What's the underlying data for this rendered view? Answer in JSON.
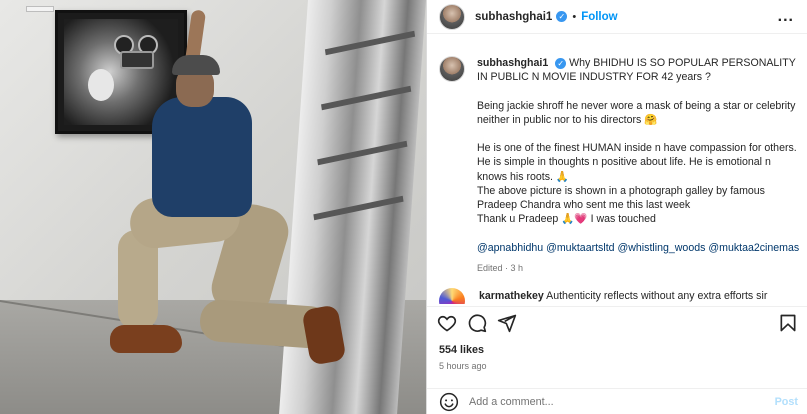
{
  "header": {
    "username": "subhashghai1",
    "separator": "•",
    "follow_label": "Follow",
    "more_label": "..."
  },
  "caption": {
    "username": "subhashghai1",
    "line1": "Why BHIDHU IS SO POPULAR PERSONALITY IN PUBLIC N MOVIE INDUSTRY FOR 42 years ?",
    "para1": "Being jackie shroff he never wore a mask of being a star or celebrity neither in public nor to his directors",
    "para1_emoji": "🤗",
    "para2": "He is one of the finest HUMAN inside n have compassion for others. He is simple in thoughts n positive about life. He is emotional n knows his roots.",
    "para2_emoji": "🙏",
    "para3": "The above picture is shown in a photograph galley by famous Pradeep Chandra who sent me this last week",
    "para4_start": "Thank u Pradeep",
    "para4_emojis": "🙏💗",
    "para4_end": "I was touched",
    "mentions": [
      "@apnabhidhu",
      "@muktaartsltd",
      "@whistling_woods",
      "@muktaa2cinemas"
    ],
    "edited": "Edited · 3 h"
  },
  "comment": {
    "username": "karmathekey",
    "text": "Authenticity reflects without any extra efforts sir"
  },
  "actions": {
    "like_icon": "heart-icon",
    "comment_icon": "comment-icon",
    "share_icon": "share-icon",
    "save_icon": "bookmark-icon"
  },
  "stats": {
    "likes": "554 likes",
    "time": "5 hours ago"
  },
  "add_comment": {
    "placeholder": "Add a comment...",
    "post_label": "Post"
  },
  "colors": {
    "accent": "#0095f6",
    "mention": "#00376b",
    "verified": "#3897f0",
    "muted": "#737373"
  }
}
